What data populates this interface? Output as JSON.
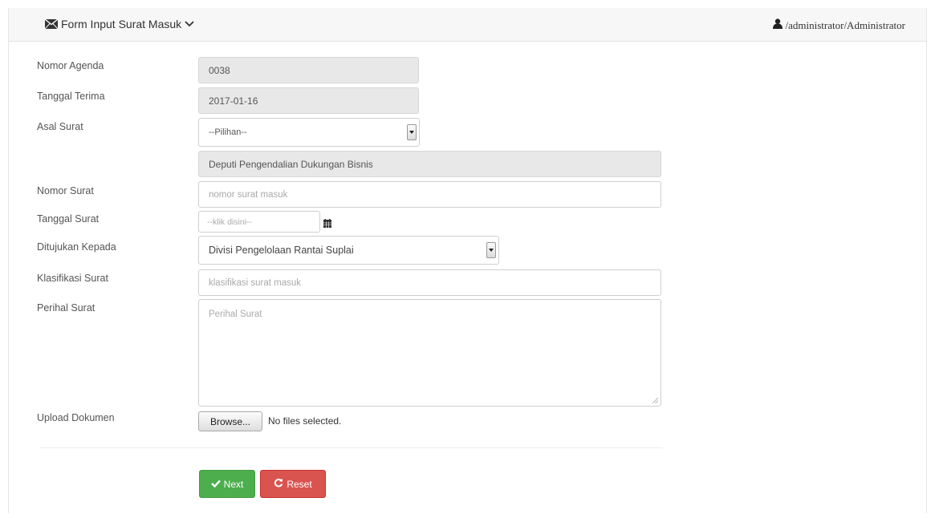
{
  "header": {
    "title": "Form Input Surat Masuk",
    "title_icon": "envelope-icon",
    "dropdown_icon": "chevron-down-icon",
    "user_icon": "user-icon",
    "user": "/administrator/Administrator"
  },
  "form": {
    "nomor_agenda": {
      "label": "Nomor Agenda",
      "value": "0038"
    },
    "tanggal_terima": {
      "label": "Tanggal Terima",
      "value": "2017-01-16"
    },
    "asal_surat": {
      "label": "Asal Surat",
      "selected": "--Pilihan--",
      "detail": "Deputi Pengendalian Dukungan Bisnis"
    },
    "nomor_surat": {
      "label": "Nomor Surat",
      "value": "",
      "placeholder": "nomor surat masuk"
    },
    "tanggal_surat": {
      "label": "Tanggal Surat",
      "value": "",
      "placeholder": "--klik disini--",
      "icon": "calendar-icon"
    },
    "ditujukan_kepada": {
      "label": "Ditujukan Kepada",
      "selected": "Divisi Pengelolaan Rantai Suplai"
    },
    "klasifikasi_surat": {
      "label": "Klasifikasi Surat",
      "value": "",
      "placeholder": "klasifikasi surat masuk"
    },
    "perihal_surat": {
      "label": "Perihal Surat",
      "value": "",
      "placeholder": "Perihal Surat"
    },
    "upload_dokumen": {
      "label": "Upload Dokumen",
      "button": "Browse...",
      "status": "No files selected."
    }
  },
  "actions": {
    "next_label": "Next",
    "next_icon": "check-icon",
    "reset_label": "Reset",
    "reset_icon": "refresh-icon"
  },
  "colors": {
    "success": "#4cae4c",
    "danger": "#d9534f",
    "readonly_bg": "#e8e8e8",
    "header_bg": "#f7f7f7"
  }
}
